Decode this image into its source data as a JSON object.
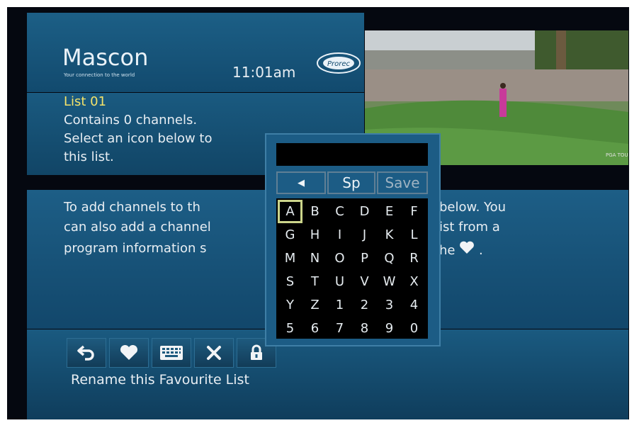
{
  "header": {
    "logo": "Mascon",
    "logo_tagline": "Your connection to the world",
    "time": "11:01am",
    "brand": "Prorec",
    "video_watermark": "PGA TOUR"
  },
  "info": {
    "title": "List 01",
    "lines": [
      "Contains 0 channels.",
      "Select an icon below to",
      "this list."
    ]
  },
  "instructions": {
    "lines": [
      " To add channels to th",
      "can also add a channel",
      "program information s"
    ],
    "lines_right": [
      "below. You",
      "ist from a",
      "he"
    ],
    "line3_suffix": "."
  },
  "keyboard": {
    "input_value": "",
    "back_label": "◀",
    "space_label": "Sp",
    "save_label": "Save",
    "selected_key": "A",
    "keys": [
      "A",
      "B",
      "C",
      "D",
      "E",
      "F",
      "G",
      "H",
      "I",
      "J",
      "K",
      "L",
      "M",
      "N",
      "O",
      "P",
      "Q",
      "R",
      "S",
      "T",
      "U",
      "V",
      "W",
      "X",
      "Y",
      "Z",
      "1",
      "2",
      "3",
      "4",
      "5",
      "6",
      "7",
      "8",
      "9",
      "0"
    ]
  },
  "toolbar": {
    "hint": "Rename this Favourite List",
    "icons": [
      "back-arrow-icon",
      "heart-icon",
      "keyboard-icon",
      "close-icon",
      "lock-icon"
    ]
  },
  "colors": {
    "panel": "#1c5e86",
    "selected_key_border": "#cbd48a",
    "title_yellow": "#f4e36a"
  }
}
